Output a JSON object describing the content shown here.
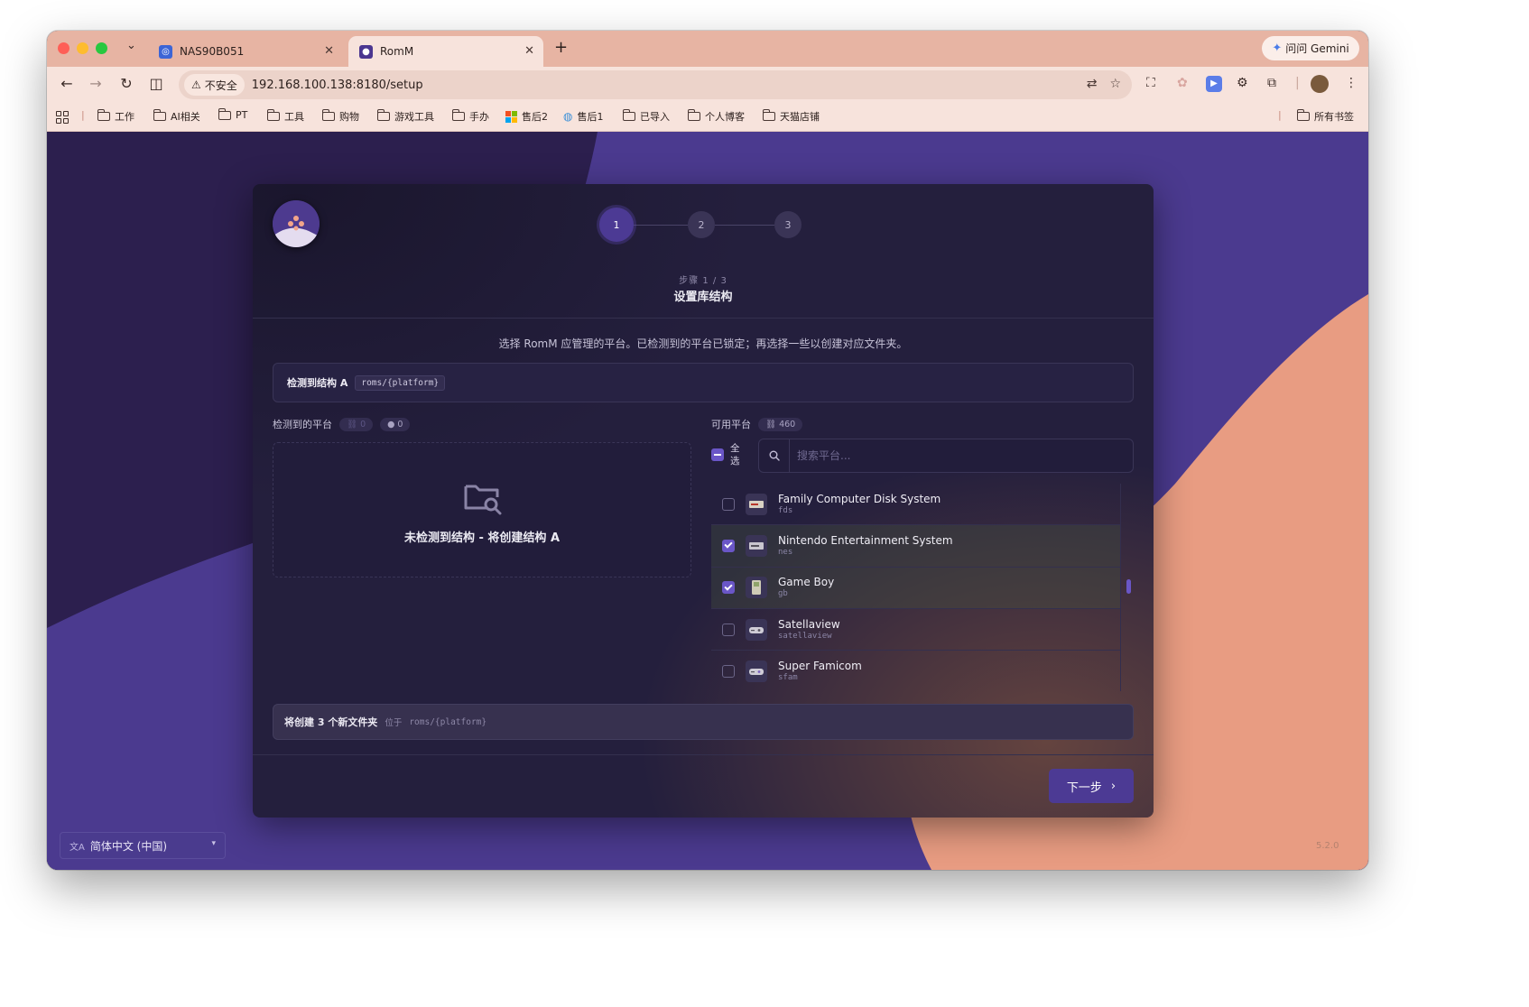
{
  "browser": {
    "tabs": [
      {
        "label": "NAS90B051"
      },
      {
        "label": "RomM"
      }
    ],
    "gemini_label": "问问 Gemini",
    "security_label": "不安全",
    "url": "192.168.100.138:8180/setup",
    "bookmarks": [
      "工作",
      "AI相关",
      "PT",
      "工具",
      "购物",
      "游戏工具",
      "手办",
      "售后2",
      "售后1",
      "已导入",
      "个人博客",
      "天猫店铺"
    ],
    "all_bookmarks": "所有书签"
  },
  "setup": {
    "steps": [
      "1",
      "2",
      "3"
    ],
    "current_step": 1,
    "step_sub": "步骤 1 / 3",
    "step_title": "设置库结构",
    "description": "选择 RomM 应管理的平台。已检测到的平台已锁定；再选择一些以创建对应文件夹。",
    "detected_structure_label": "检测到结构 A",
    "structure_path": "roms/{platform}",
    "detected_platforms_label": "检测到的平台",
    "detected_count_linked": "0",
    "detected_count_dot": "0",
    "empty_text": "未检测到结构 - 将创建结构 A",
    "available_platforms_label": "可用平台",
    "available_count": "460",
    "select_all_label": "全选",
    "search_placeholder": "搜索平台...",
    "platforms": [
      {
        "name": "Family Computer Disk System",
        "slug": "fds",
        "checked": false
      },
      {
        "name": "Nintendo Entertainment System",
        "slug": "nes",
        "checked": true
      },
      {
        "name": "Game Boy",
        "slug": "gb",
        "checked": true
      },
      {
        "name": "Satellaview",
        "slug": "satellaview",
        "checked": false
      },
      {
        "name": "Super Famicom",
        "slug": "sfam",
        "checked": false
      }
    ],
    "create_summary": "将创建 3 个新文件夹",
    "create_location_prefix": "位于",
    "create_location_path": "roms/{platform}",
    "next_label": "下一步"
  },
  "footer": {
    "language": "简体中文 (中国)",
    "version": "5.2.0"
  },
  "colors": {
    "accent": "#4c3a94",
    "background_purple": "#4b3a8f",
    "background_salmon": "#e89c82",
    "card": "#241f3d"
  }
}
